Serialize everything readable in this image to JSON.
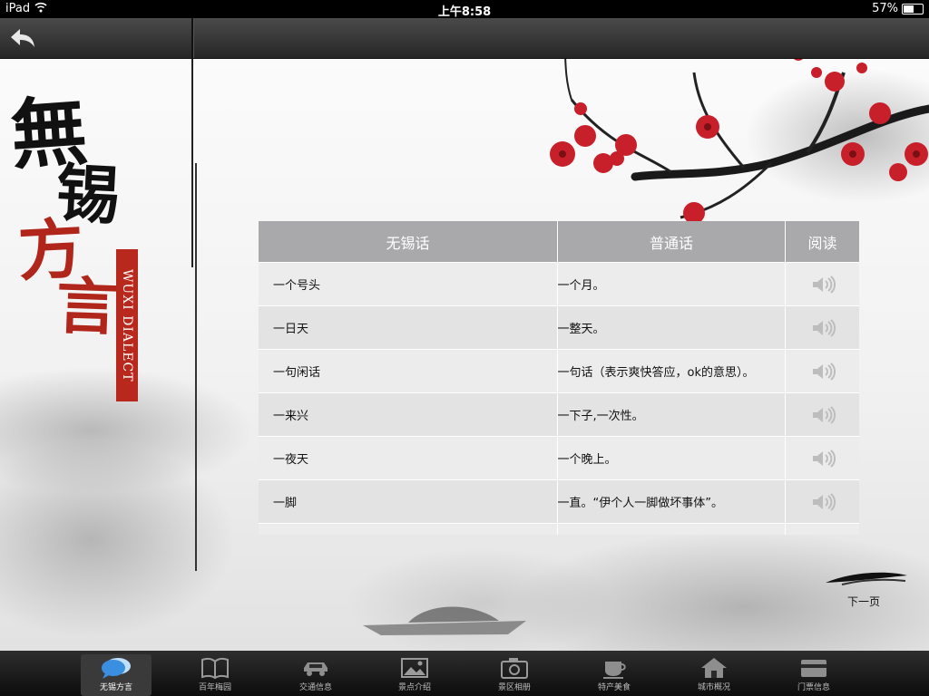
{
  "status_bar": {
    "device": "iPad",
    "time": "上午8:58",
    "battery": "57%",
    "battery_level": 0.57
  },
  "main": {
    "title_chars": [
      "無",
      "锡",
      "方",
      "言"
    ],
    "seal_text": "WUXI DIALECT",
    "table": {
      "headers": [
        "无锡话",
        "普通话",
        "阅读"
      ],
      "rows": [
        {
          "wuxi": "一个号头",
          "mandarin": "一个月。"
        },
        {
          "wuxi": "一日天",
          "mandarin": "一整天。"
        },
        {
          "wuxi": "一句闲话",
          "mandarin": "一句话（表示爽快答应，ok的意思）。"
        },
        {
          "wuxi": "一来兴",
          "mandarin": "一下子,一次性。"
        },
        {
          "wuxi": "一夜天",
          "mandarin": "一个晚上。"
        },
        {
          "wuxi": "一脚",
          "mandarin": "一直。“伊个人一脚做坏事体”。"
        }
      ]
    },
    "next_page_label": "下一页"
  },
  "tabbar": {
    "items": [
      {
        "label": "无锡方言",
        "icon": "speech-bubble-icon",
        "active": true
      },
      {
        "label": "百年梅园",
        "icon": "book-icon",
        "active": false
      },
      {
        "label": "交通信息",
        "icon": "car-icon",
        "active": false
      },
      {
        "label": "景点介绍",
        "icon": "picture-icon",
        "active": false
      },
      {
        "label": "景区相册",
        "icon": "camera-icon",
        "active": false
      },
      {
        "label": "特产美食",
        "icon": "coffee-cup-icon",
        "active": false
      },
      {
        "label": "城市概况",
        "icon": "home-icon",
        "active": false
      },
      {
        "label": "门票信息",
        "icon": "ticket-icon",
        "active": false
      }
    ]
  },
  "colors": {
    "seal_red": "#b8281c",
    "table_header": "#a9a9ab",
    "tabbar": "#1a1a1a",
    "active_icon": "#3b8fe0"
  }
}
